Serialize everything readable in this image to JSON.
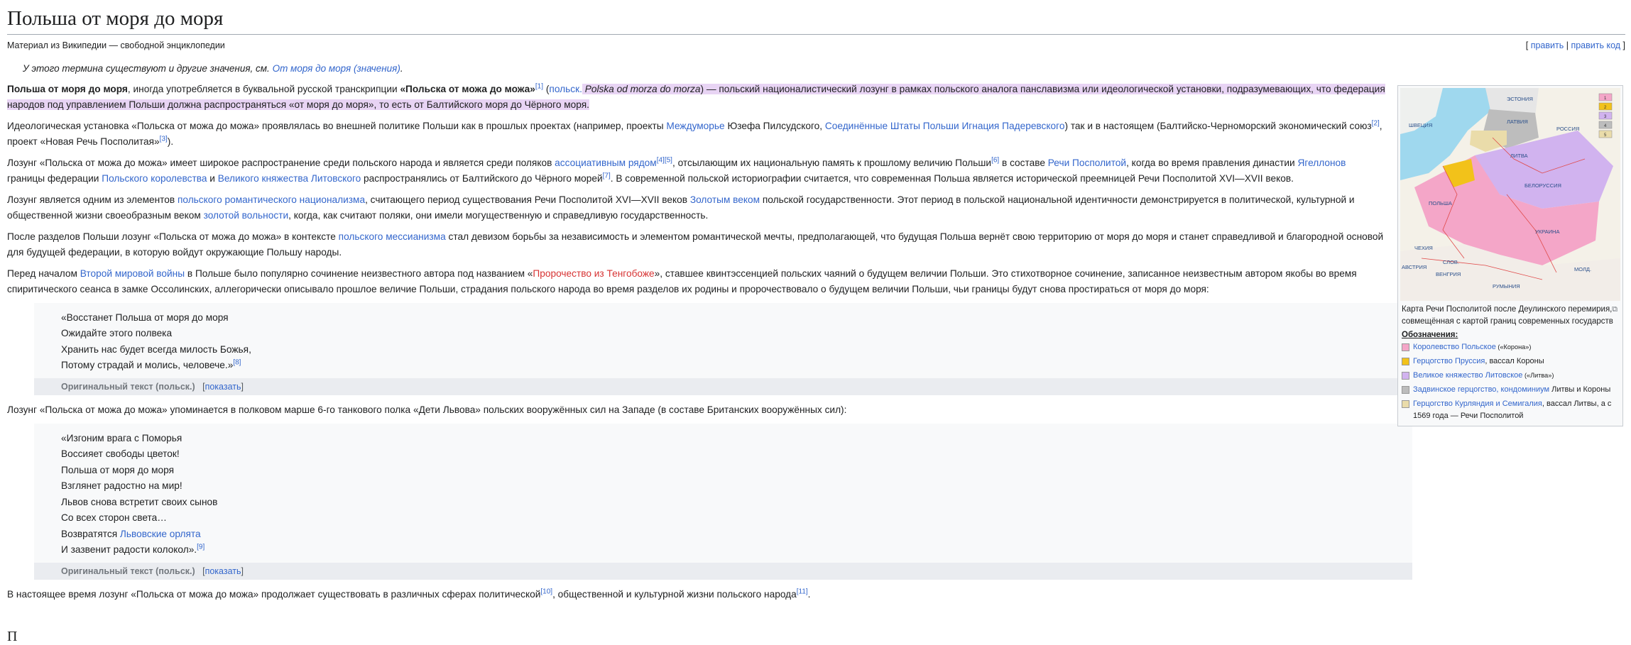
{
  "page": {
    "title": "Польша от моря до моря",
    "subtitle": "Материал из Википедии — свободной энциклопедии",
    "edit_links": {
      "open": "[ ",
      "edit": "править",
      "sep": " | ",
      "edit_code": "править код",
      "close": " ]"
    }
  },
  "hatnote": {
    "text": "У этого термина существуют и другие значения, см. ",
    "link": "От моря до моря (значения)",
    "end": "."
  },
  "p1": {
    "bold": "Польша от моря до моря",
    "t1": ", иногда употребляется в буквальной русской транскрипции ",
    "bold2": "«Польска от можа до можа»",
    "ref1": "[1]",
    "t2": " (",
    "lang": "польск.",
    "t3": " ",
    "italic": "Polska od morza do morza",
    "t4": ") — польский националистический лозунг в рамках польского аналога панславизма или идеологической установки, подразумевающих, что федерация народов под управлением Польши должна распространяться «от моря до моря», то есть от Балтийского моря до Чёрного моря."
  },
  "p2": {
    "t1": "Идеологическая установка «Польска от можа до можа» проявлялась во внешней политике Польши как в прошлых проектах (например, проекты ",
    "l1": "Междуморье",
    "t2": " Юзефа Пилсудского, ",
    "l2": "Соединённые Штаты Польши Игнация Падеревского",
    "t3": ") так и в настоящем (Балтийско-Черноморский экономический союз",
    "ref2": "[2]",
    "t4": ", проект «Новая Речь Посполитая»",
    "ref3": "[3]",
    "t5": ")."
  },
  "p3": {
    "t1": "Лозунг «Польска от можа до можа» имеет широкое распространение среди польского народа и является среди поляков ",
    "l1": "ассоциативным рядом",
    "ref": "[4][5]",
    "t2": ", отсылающим их национальную память к прошлому величию Польши",
    "ref6": "[6]",
    "t3": " в составе ",
    "l2": "Речи Посполитой",
    "t4": ", когда во время правления династии ",
    "l3": "Ягеллонов",
    "t5": " границы федерации ",
    "l4": "Польского королевства",
    "t6": " и ",
    "l5": "Великого княжества Литовского",
    "t7": " распространялись от Балтийского до Чёрного морей",
    "ref7": "[7]",
    "t8": ". В современной польской историографии считается, что современная Польша является исторической преемницей Речи Посполитой XVI—XVII веков."
  },
  "p4": {
    "t1": "Лозунг является одним из элементов ",
    "l1": "польского романтического национализма",
    "t2": ", считающего период существования Речи Посполитой XVI—XVII веков ",
    "l2": "Золотым веком",
    "t3": " польской государственности. Этот период в польской национальной идентичности демонстрируется в политической, культурной и общественной жизни своеобразным веком ",
    "l3": "золотой вольности",
    "t4": ", когда, как считают поляки, они имели могущественную и справедливую государственность."
  },
  "p5": {
    "t1": "После разделов Польши лозунг «Польска от можа до можа» в контексте ",
    "l1": "польского мессианизма",
    "t2": " стал девизом борьбы за независимость и элементом романтической мечты, предполагающей, что будущая Польша вернёт свою территорию от моря до моря и станет справедливой и благородной основой для будущей федерации, в которую войдут окружающие Польшу народы."
  },
  "p6": {
    "t1": "Перед началом ",
    "l1": "Второй мировой войны",
    "t2": " в Польше было популярно сочинение неизвестного автора под названием «",
    "l2": "Пророчество из Тенгобоже",
    "t3": "», ставшее квинтэссенцией польских чаяний о будущем величии Польши. Это стихотворное сочинение, записанное неизвестным автором якобы во время спиритического сеанса в замке Оссолинских, аллегорически описывало прошлое величие Польши, страдания польского народа во время разделов их родины и пророчествовало о будущем величии Польши, чьи границы будут снова простираться от моря до моря:"
  },
  "quote1": {
    "lines": [
      "«Восстанет Польша от моря до моря",
      "Ожидайте этого полвека",
      "Хранить нас будет всегда милость Божья,",
      "Потому страдай и молись, человече.»"
    ],
    "ref": "[8]",
    "orig_label": "Оригинальный текст (польск.)",
    "show": "показать"
  },
  "p7": {
    "text": "Лозунг «Польска от можа до можа» упоминается в полковом марше 6-го танкового полка «Дети Львова» польских вооружённых сил на Западе (в составе Британских вооружённых сил):"
  },
  "quote2": {
    "lines": [
      "«Изгоним врага с Поморья",
      "Воссияет свободы цветок!",
      "Польша от моря до моря",
      "Взглянет радостно на мир!",
      "Львов снова встретит своих сынов",
      "Со всех сторон света…"
    ],
    "line7_text": "Возвратятся ",
    "line7_link": "Львовские орлята",
    "line8": "И зазвенит радости колокол».",
    "ref": "[9]",
    "orig_label": "Оригинальный текст (польск.)",
    "show": "показать"
  },
  "p8": {
    "t1": "В настоящее время лозунг «Польска от можа до можа» продолжает существовать в различных сферах политической",
    "ref10": "[10]",
    "t2": ", общественной и культурной жизни польского народа",
    "ref11": "[11]",
    "t3": "."
  },
  "next_heading": "П",
  "infobox": {
    "map_labels": [
      "ШВЕЦИЯ",
      "ЭСТОНИЯ",
      "ЛАТВИЯ",
      "РОССИЯ",
      "ЛИТВА",
      "БЕЛОРУССИЯ",
      "ПОЛЬША",
      "УКРАИНА",
      "АВСТРИЯ",
      "ВЕНГРИЯ",
      "РУМЫНИЯ",
      "ЧЕХИЯ",
      "СЛОВ.",
      "МОЛД."
    ],
    "map_legend_nums": [
      "1",
      "2",
      "3",
      "4",
      "5"
    ],
    "caption": "Карта Речи Посполитой после Деулинского перемирия, совмещённая с картой границ современных государств",
    "legend_title": "Обозначения:",
    "legend": [
      {
        "color": "#f4a6c8",
        "link": "Королевство Польское",
        "small": " («Корона»)",
        "extra": ""
      },
      {
        "color": "#f2c21a",
        "link": "Герцогство Пруссия",
        "small": "",
        "extra": ", вассал Короны"
      },
      {
        "color": "#d1b3ef",
        "link": "Великое княжество Литовское",
        "small": " («Литва»)",
        "extra": ""
      },
      {
        "color": "#bcbcbc",
        "link": "Задвинское герцогство, кондоминиум",
        "small": "",
        "extra": " Литвы и Короны"
      },
      {
        "color": "#eadcaa",
        "link": "Герцогство Курляндия и Семигалия",
        "small": "",
        "extra": ", вассал Литвы, а с 1569 года — Речи Посполитой"
      }
    ]
  }
}
